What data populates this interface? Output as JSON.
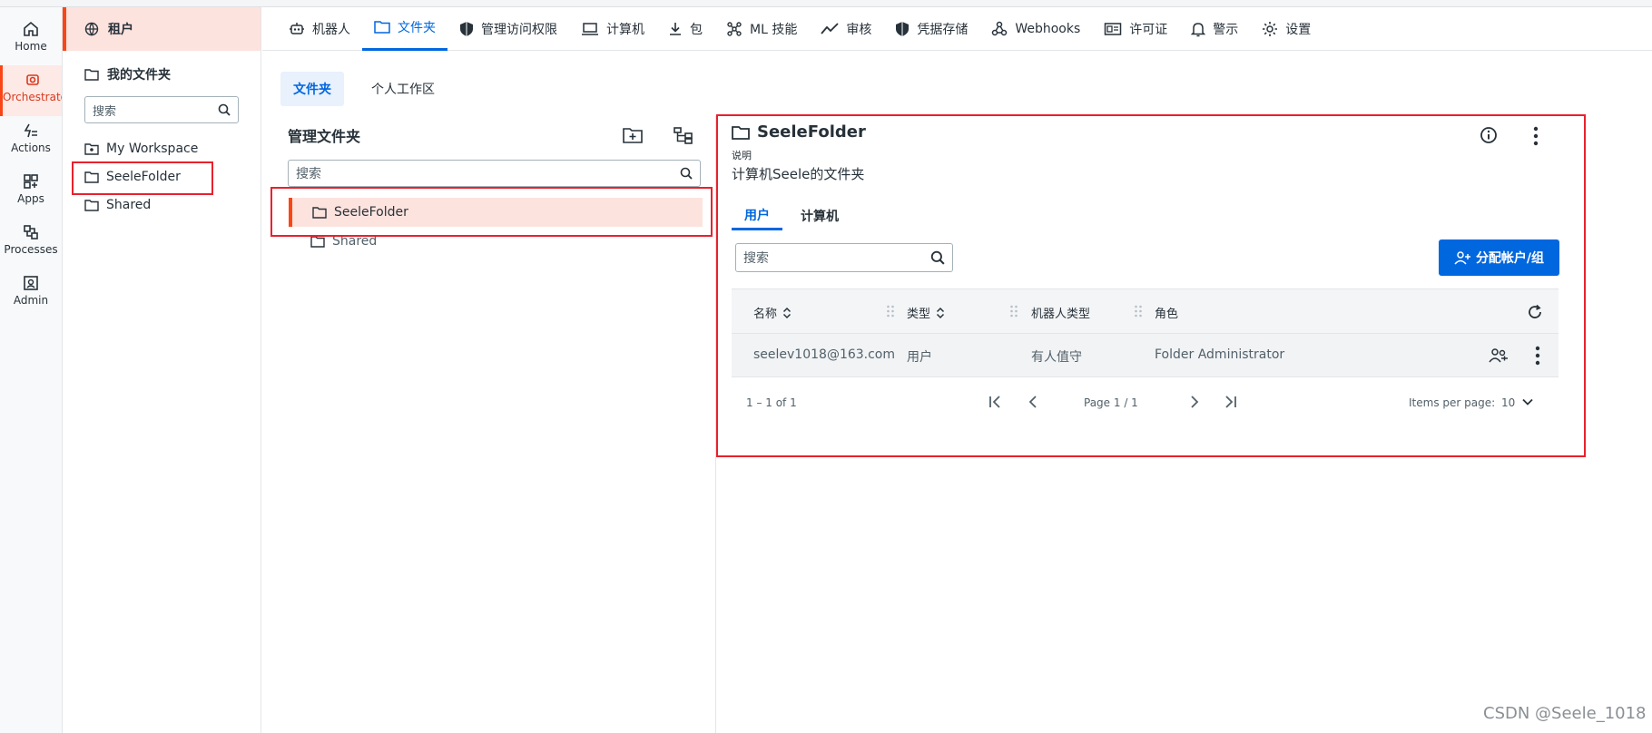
{
  "rail": {
    "items": [
      {
        "label": "Home",
        "icon": "home-icon"
      },
      {
        "label": "Orchestrator",
        "icon": "orchestrator-icon"
      },
      {
        "label": "Actions",
        "icon": "actions-icon"
      },
      {
        "label": "Apps",
        "icon": "apps-icon"
      },
      {
        "label": "Processes",
        "icon": "processes-icon"
      },
      {
        "label": "Admin",
        "icon": "admin-icon"
      }
    ]
  },
  "sidebar": {
    "tenant": "租户",
    "my_folders": "我的文件夹",
    "search_placeholder": "搜索",
    "nodes": [
      "My Workspace",
      "SeeleFolder",
      "Shared"
    ]
  },
  "topnav": {
    "tabs": [
      "机器人",
      "文件夹",
      "管理访问权限",
      "计算机",
      "包",
      "ML 技能",
      "审核",
      "凭据存储",
      "Webhooks",
      "许可证",
      "警示",
      "设置"
    ],
    "active": "文件夹"
  },
  "subtabs": [
    "文件夹",
    "个人工作区"
  ],
  "manage": {
    "title": "管理文件夹",
    "search_placeholder": "搜索",
    "tree": [
      "SeeleFolder",
      "Shared"
    ]
  },
  "detail": {
    "title": "SeeleFolder",
    "desc_label": "说明",
    "desc": "计算机Seele的文件夹",
    "tabs": [
      "用户",
      "计算机"
    ],
    "search_placeholder": "搜索",
    "assign_button": "分配帐户/组",
    "columns": [
      "名称",
      "类型",
      "机器人类型",
      "角色"
    ],
    "rows": [
      {
        "name": "seelev1018@163.com",
        "type": "用户",
        "robot_type": "有人值守",
        "role": "Folder Administrator"
      }
    ],
    "pager": {
      "range": "1 – 1 of 1",
      "page": "Page 1 / 1",
      "items_per_page_label": "Items per page:",
      "items_per_page": "10"
    }
  },
  "watermark": "CSDN @Seele_1018",
  "colors": {
    "accent": "#0067df",
    "brand": "#fa4616",
    "highlight": "#e8212d"
  }
}
